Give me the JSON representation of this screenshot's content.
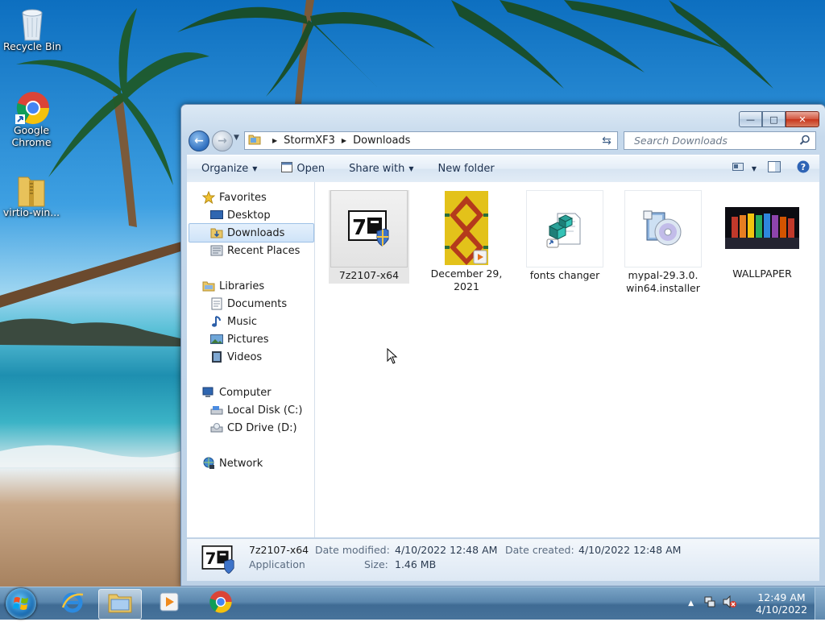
{
  "desktop": {
    "icons": [
      {
        "label": "Recycle Bin",
        "icon": "recycle-bin-icon"
      },
      {
        "label": "Google Chrome",
        "icon": "chrome-icon"
      },
      {
        "label": "virtio-win...",
        "icon": "zip-folder-icon"
      }
    ]
  },
  "window": {
    "address": {
      "root": "StormXF3",
      "current": "Downloads"
    },
    "search_placeholder": "Search Downloads",
    "toolbar": {
      "organize": "Organize",
      "open": "Open",
      "share_with": "Share with",
      "new_folder": "New folder"
    },
    "nav": {
      "favorites": "Favorites",
      "desktop": "Desktop",
      "downloads": "Downloads",
      "recent_places": "Recent Places",
      "libraries": "Libraries",
      "documents": "Documents",
      "music": "Music",
      "pictures": "Pictures",
      "videos": "Videos",
      "computer": "Computer",
      "local_disk": "Local Disk (C:)",
      "cd_drive": "CD Drive (D:)",
      "network": "Network"
    },
    "files": [
      {
        "name": "7z2107-x64",
        "icon": "7zip-installer-icon",
        "selected": true
      },
      {
        "name": "December 29, 2021",
        "icon": "video-thumbnail-icon",
        "selected": false
      },
      {
        "name": "fonts changer",
        "icon": "script-file-icon",
        "selected": false
      },
      {
        "name": "mypal-29.3.0.win64.installer",
        "icon": "installer-disc-icon",
        "selected": false
      },
      {
        "name": "WALLPAPER",
        "icon": "image-thumbnail-icon",
        "selected": false
      }
    ],
    "details": {
      "name": "7z2107-x64",
      "type": "Application",
      "date_modified_label": "Date modified:",
      "date_modified": "4/10/2022 12:48 AM",
      "date_created_label": "Date created:",
      "date_created": "4/10/2022 12:48 AM",
      "size_label": "Size:",
      "size": "1.46 MB"
    }
  },
  "taskbar": {
    "apps": [
      "internet-explorer-icon",
      "explorer-icon",
      "media-player-icon",
      "chrome-icon"
    ],
    "clock_time": "12:49 AM",
    "clock_date": "4/10/2022"
  },
  "colors": {
    "selection": "#cfe3f8",
    "window_frame": "#c6d9ec",
    "taskbar": "#47739b"
  }
}
